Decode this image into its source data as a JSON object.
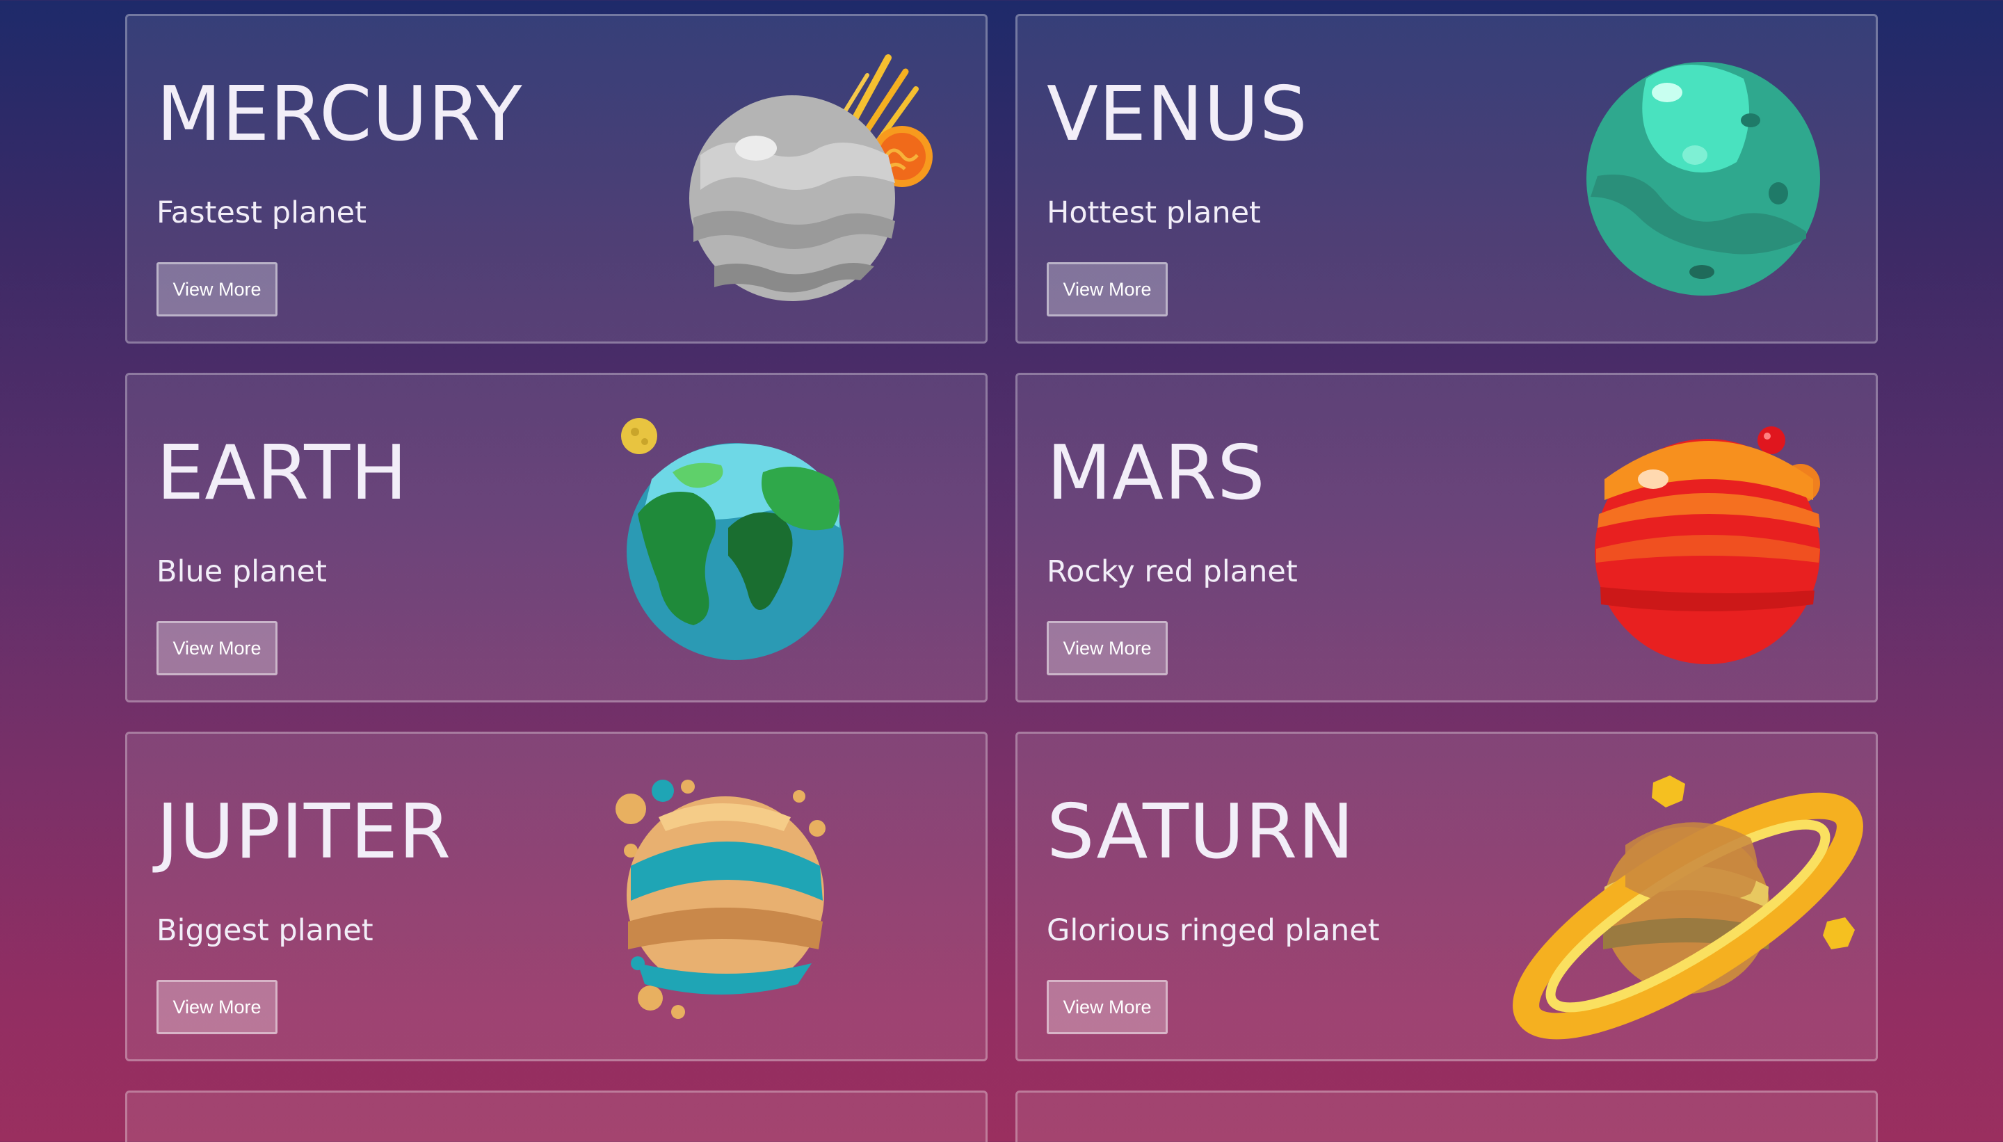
{
  "planets": [
    {
      "name": "MERCURY",
      "subtitle": "Fastest planet",
      "button": "View More",
      "icon": "mercury-planet-icon"
    },
    {
      "name": "VENUS",
      "subtitle": "Hottest planet",
      "button": "View More",
      "icon": "venus-planet-icon"
    },
    {
      "name": "EARTH",
      "subtitle": "Blue planet",
      "button": "View More",
      "icon": "earth-planet-icon"
    },
    {
      "name": "MARS",
      "subtitle": "Rocky red planet",
      "button": "View More",
      "icon": "mars-planet-icon"
    },
    {
      "name": "JUPITER",
      "subtitle": "Biggest planet",
      "button": "View More",
      "icon": "jupiter-planet-icon"
    },
    {
      "name": "SATURN",
      "subtitle": "Glorious ringed planet",
      "button": "View More",
      "icon": "saturn-planet-icon"
    }
  ],
  "colors": {
    "background_top": "#1e2a6a",
    "background_bottom": "#9a2f5f",
    "text": "#f2eef8"
  }
}
